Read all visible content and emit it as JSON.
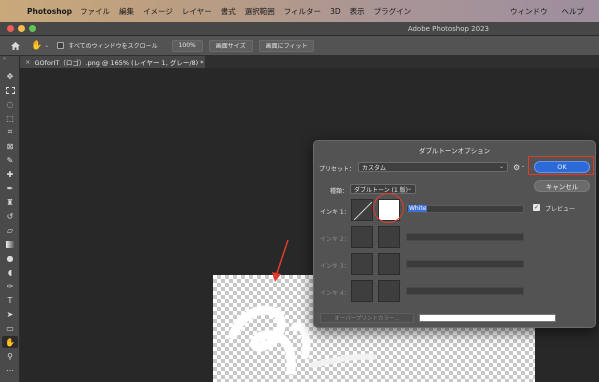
{
  "menubar": {
    "app": "Photoshop",
    "items": [
      "ファイル",
      "編集",
      "イメージ",
      "レイヤー",
      "書式",
      "選択範囲",
      "フィルター",
      "3D",
      "表示",
      "プラグイン"
    ],
    "right_items": [
      "ウィンドウ",
      "ヘルプ"
    ]
  },
  "window": {
    "title": "Adobe Photoshop 2023"
  },
  "options": {
    "scroll_all_label": "すべてのウィンドウをスクロール",
    "zoom_100": "100%",
    "fit_screen": "画面サイズ",
    "fill_screen": "画面にフィット"
  },
  "document": {
    "tab_title": "GOforIT（ロゴ）.png @ 165% (レイヤー 1, グレー/8) *"
  },
  "dialog": {
    "title": "ダブルトーンオプション",
    "preset_label": "プリセット：",
    "preset_value": "カスタム",
    "type_label": "種類：",
    "type_value": "ダブルトーン (1 版)",
    "ink1_label": "インキ 1：",
    "ink1_name": "White",
    "ink2_label": "インキ 2：",
    "ink3_label": "インキ 3：",
    "ink4_label": "インキ 4：",
    "overprint_label": "オーバープリントカラー...",
    "ok_label": "OK",
    "cancel_label": "キャンセル",
    "preview_label": "プレビュー"
  },
  "colors": {
    "ok_button": "#2d6ad9",
    "annotation": "#e03c2c"
  }
}
